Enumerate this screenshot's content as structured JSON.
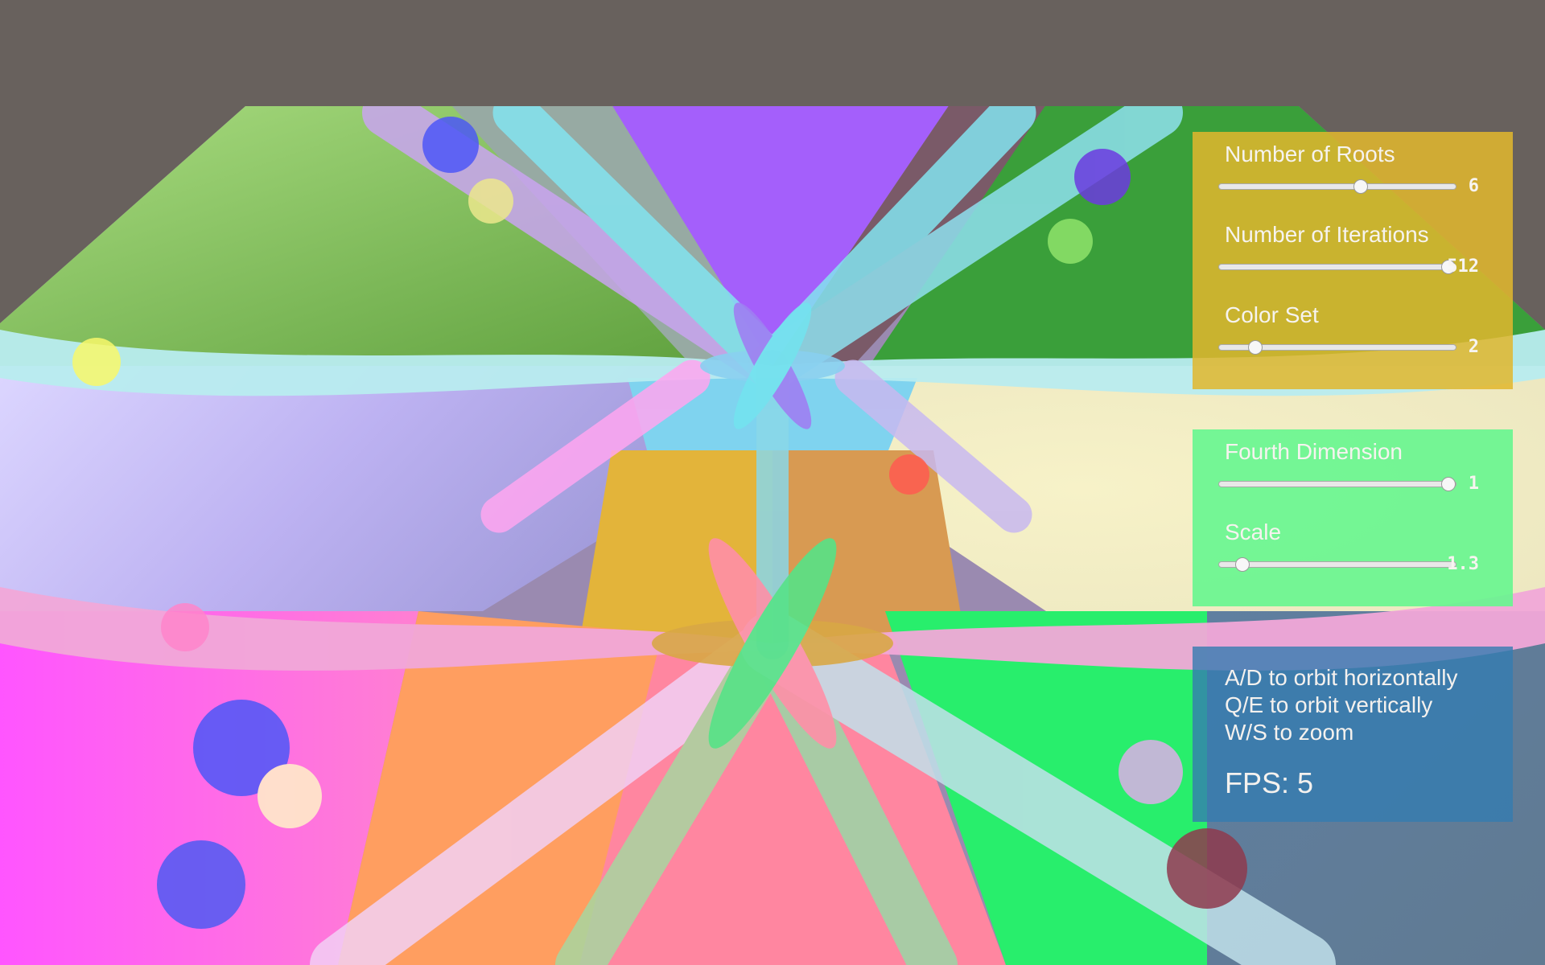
{
  "fractal_controls": [
    {
      "label": "Number of Roots",
      "value": "6",
      "level": 0.6
    },
    {
      "label": "Number of Iterations",
      "value": "512",
      "level": 1.0
    },
    {
      "label": "Color Set",
      "value": "2",
      "level": 0.15
    }
  ],
  "view_controls": [
    {
      "label": "Fourth Dimension",
      "value": "1",
      "level": 1.0
    },
    {
      "label": "Scale",
      "value": "1.3",
      "level": 0.1
    }
  ],
  "help": {
    "lines": [
      "A/D to orbit horizontally",
      "Q/E to orbit vertically",
      "W/S to zoom"
    ],
    "fps_text": "FPS: 5"
  },
  "colors": {
    "background": "#68615d",
    "fractal_panel": "#e1b72d",
    "view_panel": "#66f68f",
    "help_panel": "#347cb0",
    "basin_colors": [
      "#a45ffb",
      "#3a9f3a",
      "#f0ecc4",
      "#28ee6c",
      "#ff86a0",
      "#ff9e60",
      "#ff55ff",
      "#c8c2f4",
      "#7bb64f"
    ]
  }
}
